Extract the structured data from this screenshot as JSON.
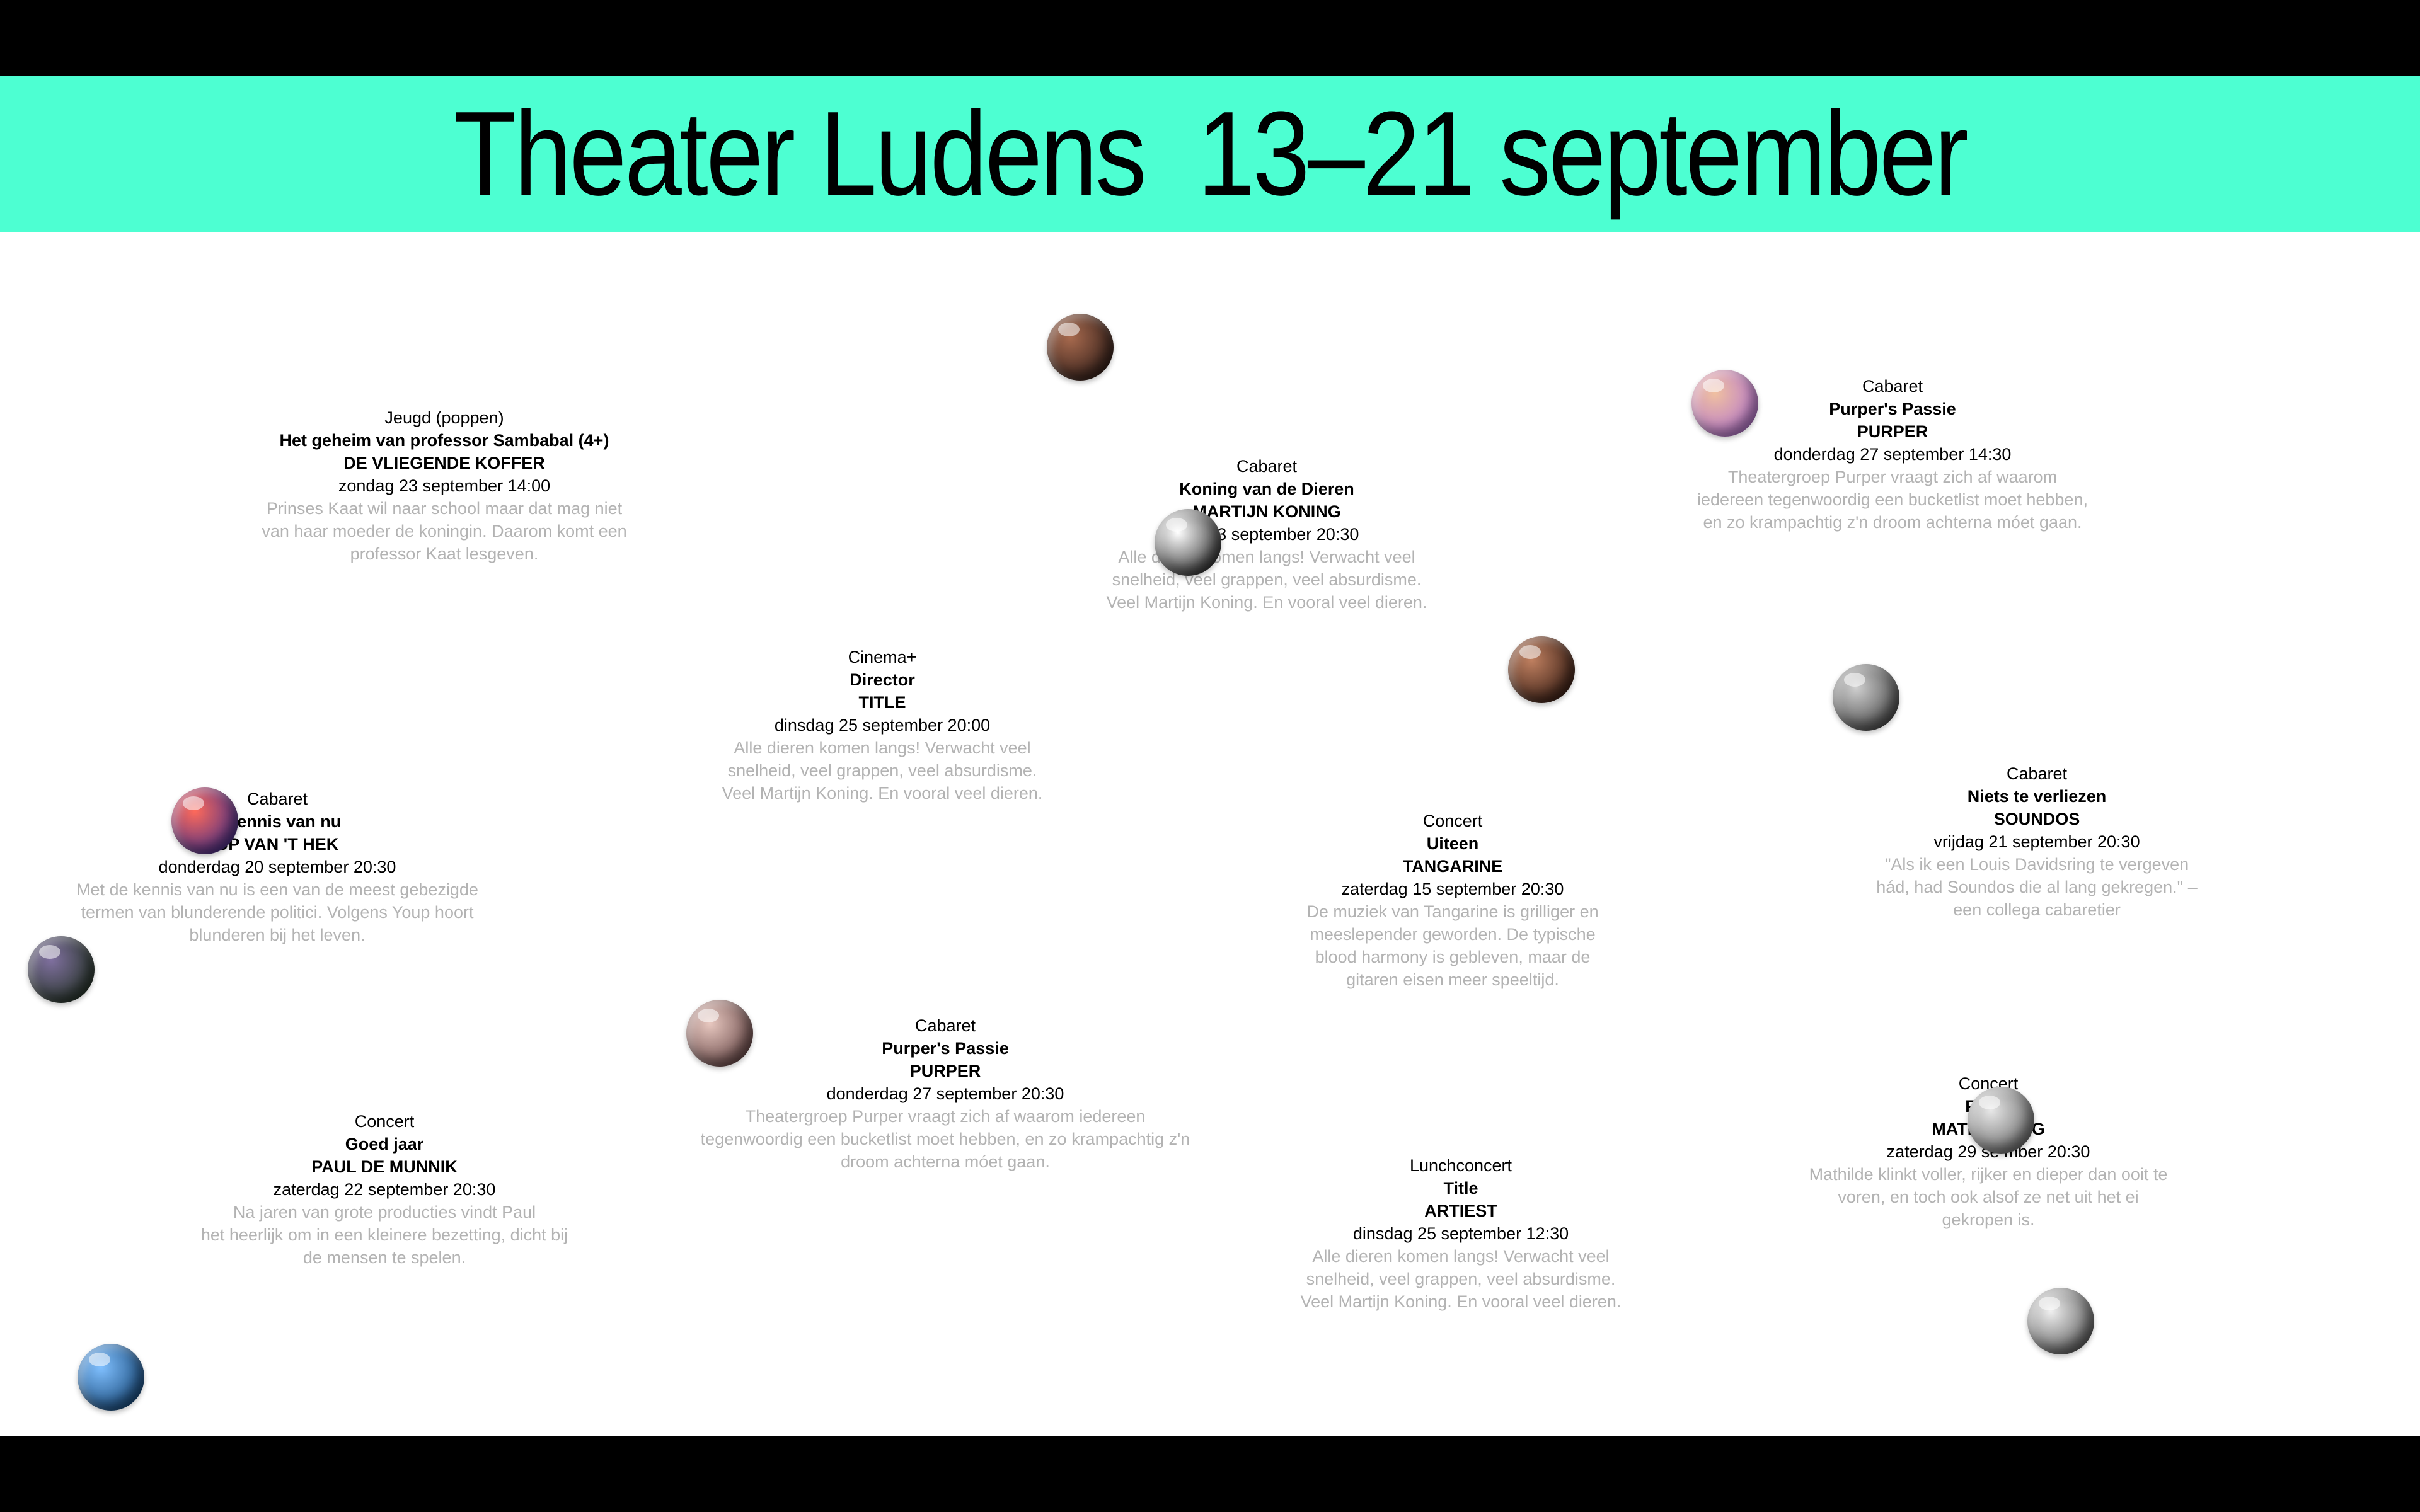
{
  "header": {
    "title": "Theater Ludens  13–21 september"
  },
  "events": [
    {
      "genre": "Jeugd (poppen)",
      "title": "Het geheim van professor Sambabal (4+)",
      "artist": "DE VLIEGENDE KOFFER",
      "date": "zondag 23 september 14:00",
      "desc": [
        "Prinses Kaat wil naar school maar dat mag niet",
        "van haar moeder de koningin. Daarom komt een",
        "professor Kaat lesgeven."
      ]
    },
    {
      "genre": "Cabaret",
      "title": "Koning van de Dieren",
      "artist": "MARTIJN KONING",
      "date": "dag 13 september 20:30",
      "desc": [
        "Alle dieren komen langs! Verwacht veel",
        "snelheid, veel grappen, veel absurdisme.",
        "Veel Martijn Koning. En vooral veel dieren."
      ]
    },
    {
      "genre": "Cabaret",
      "title": "Purper's Passie",
      "artist": "PURPER",
      "date": "donderdag 27 september 14:30",
      "desc": [
        "Theatergroep Purper vraagt zich af waarom",
        "iedereen tegenwoordig een bucketlist moet hebben,",
        "en zo krampachtig z'n droom achterna móet gaan."
      ]
    },
    {
      "genre": "Cinema+",
      "title": "Director",
      "artist": "TITLE",
      "date": "dinsdag 25 september 20:00",
      "desc": [
        "Alle dieren komen langs! Verwacht veel",
        "snelheid, veel grappen, veel absurdisme.",
        "Veel Martijn Koning. En vooral veel dieren."
      ]
    },
    {
      "genre": "Cabaret",
      "title": "e kennis van nu",
      "artist": "UP VAN 'T HEK",
      "date": "donderdag 20 september 20:30",
      "desc": [
        "Met de kennis van nu is een van de meest gebezigde",
        "termen van blunderende politici. Volgens Youp hoort",
        "blunderen bij het leven."
      ]
    },
    {
      "genre": "Concert",
      "title": "Uiteen",
      "artist": "TANGARINE",
      "date": "zaterdag 15 september 20:30",
      "desc": [
        "De muziek van Tangarine is grilliger en",
        "meeslepender geworden. De typische",
        "blood harmony is gebleven, maar de",
        "gitaren eisen meer speeltijd."
      ]
    },
    {
      "genre": "Cabaret",
      "title": "Niets te verliezen",
      "artist": "SOUNDOS",
      "date": "vrijdag 21 september 20:30",
      "desc": [
        "\"Als ik een Louis Davidsring te vergeven",
        "hád, had Soundos die al lang gekregen.\" –",
        "een collega cabaretier"
      ]
    },
    {
      "genre": "Cabaret",
      "title": "Purper's Passie",
      "artist": "PURPER",
      "date": "donderdag 27 september 20:30",
      "desc": [
        "Theatergroep Purper vraagt zich af waarom iedereen",
        "tegenwoordig een bucketlist moet hebben, en zo krampachtig z'n",
        "droom achterna móet gaan."
      ]
    },
    {
      "genre": "Concert",
      "title": "Goed jaar",
      "artist": "PAUL DE MUNNIK",
      "date": "zaterdag 22 september 20:30",
      "desc": [
        "Na jaren van grote producties vindt Paul",
        "het heerlijk om in een kleinere bezetting, dicht bij",
        "de mensen te spelen."
      ]
    },
    {
      "genre": "Lunchconcert",
      "title": "Title",
      "artist": "ARTIEST",
      "date": "dinsdag 25 september 12:30",
      "desc": [
        "Alle dieren komen langs! Verwacht veel",
        "snelheid, veel grappen, veel absurdisme.",
        "Veel Martijn Koning. En vooral veel dieren."
      ]
    },
    {
      "genre": "Concert",
      "title": "Ren          e",
      "artist": "MATHILI         TING",
      "date": "zaterdag 29 se     mber 20:30",
      "desc": [
        "Mathilde klinkt voller, rijker en dieper dan ooit te",
        "voren, en toch ook alsof ze net uit het ei",
        "gekropen is."
      ]
    }
  ],
  "bubbles": [
    {
      "name": "portrait-bubble-1",
      "colors": [
        "#a86a4e",
        "#2b1a16"
      ]
    },
    {
      "name": "portrait-bubble-2",
      "colors": [
        "#f0c0a0",
        "#b070d0"
      ]
    },
    {
      "name": "portrait-bubble-3",
      "colors": [
        "#ffffff",
        "#222222"
      ]
    },
    {
      "name": "portrait-bubble-4",
      "colors": [
        "#c08060",
        "#301810"
      ]
    },
    {
      "name": "portrait-bubble-5",
      "colors": [
        "#d0d0d0",
        "#404040"
      ]
    },
    {
      "name": "portrait-bubble-6",
      "colors": [
        "#ff6a5a",
        "#3a2a8a"
      ]
    },
    {
      "name": "portrait-bubble-7",
      "colors": [
        "#8070a0",
        "#203020"
      ]
    },
    {
      "name": "portrait-bubble-8",
      "colors": [
        "#e8c8c0",
        "#604040"
      ]
    },
    {
      "name": "portrait-bubble-9",
      "colors": [
        "#e8e8e8",
        "#606060"
      ]
    },
    {
      "name": "portrait-bubble-10",
      "colors": [
        "#f0f0f0",
        "#505050"
      ]
    },
    {
      "name": "portrait-bubble-11",
      "colors": [
        "#80c0ff",
        "#104070"
      ]
    }
  ]
}
